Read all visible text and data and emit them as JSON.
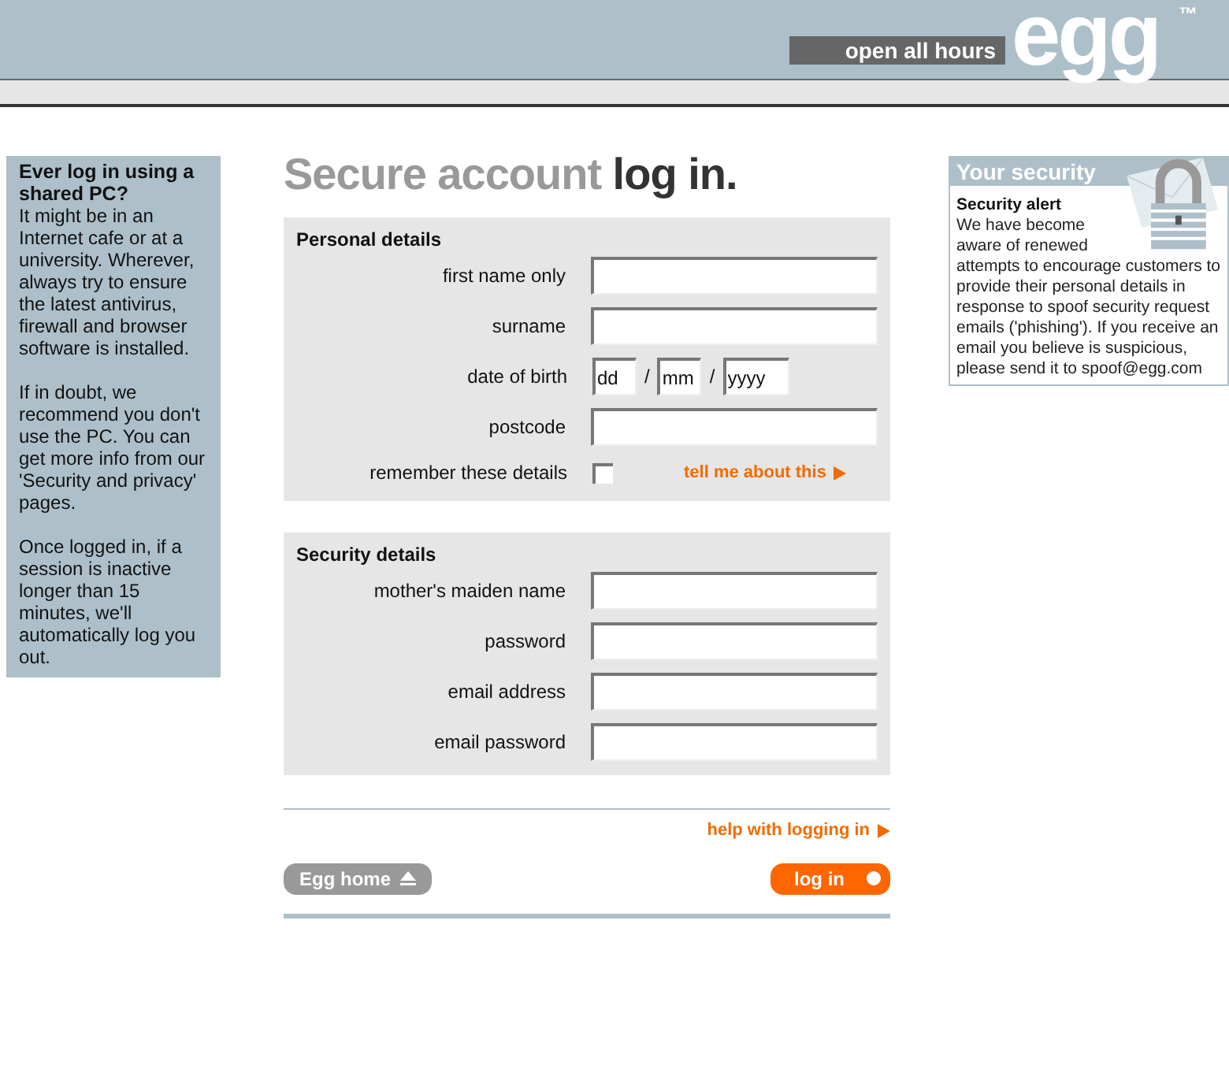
{
  "header": {
    "tagline": "open all hours",
    "logo": "egg",
    "trademark": "™"
  },
  "side_panel": {
    "heading": "Ever log in using a shared PC?",
    "paragraphs": [
      "It might be in an Internet cafe or at a university. Wherever, always try to ensure the latest antivirus, firewall and browser software is installed.",
      "If in doubt, we recommend you don't use the PC. You can get more info from our 'Security and privacy' pages.",
      "Once logged in, if a session is inactive longer than 15 minutes, we'll automatically log you out."
    ]
  },
  "title": {
    "light": "Secure account",
    "dark": "log in."
  },
  "sections": [
    {
      "heading": "Personal details",
      "fields": [
        {
          "kind": "text",
          "label": "first name only"
        },
        {
          "kind": "text",
          "label": "surname"
        },
        {
          "kind": "date",
          "label": "date of birth",
          "parts": [
            "dd",
            "mm",
            "yyyy"
          ],
          "separator": "/"
        },
        {
          "kind": "text",
          "label": "postcode"
        },
        {
          "kind": "checkbox",
          "label": "remember these details",
          "checked": false,
          "link": "tell me about this"
        }
      ]
    },
    {
      "heading": "Security details",
      "fields": [
        {
          "kind": "text",
          "label": "mother's maiden name"
        },
        {
          "kind": "text",
          "label": "password"
        },
        {
          "kind": "text",
          "label": "email address"
        },
        {
          "kind": "text",
          "label": "email password"
        }
      ]
    }
  ],
  "help_link": "help with logging in",
  "buttons": {
    "home": "Egg home",
    "login": "log in"
  },
  "security_panel": {
    "title": "Your security",
    "heading": "Security alert",
    "body": "We have become aware of renewed attempts to encourage customers to provide their personal details in response to spoof security request emails ('phishing'). If you receive an email you believe is suspicious, please send it to spoof@egg.com"
  }
}
